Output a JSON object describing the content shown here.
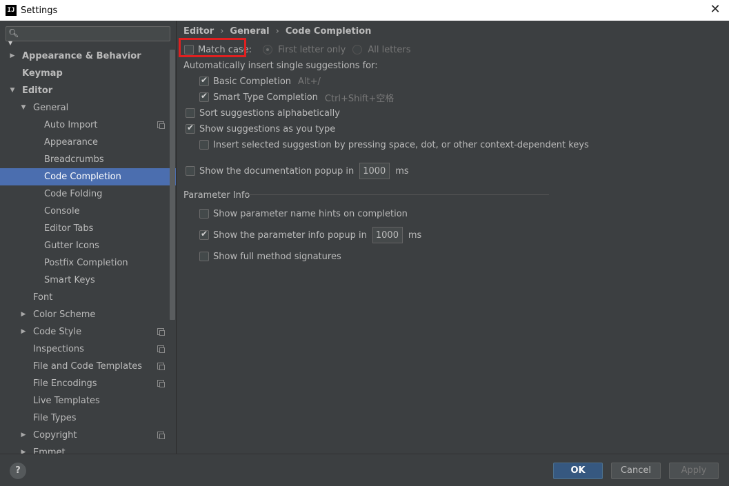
{
  "window": {
    "title": "Settings",
    "app_icon": "IJ"
  },
  "search": {
    "placeholder": ""
  },
  "sidebar": {
    "items": [
      {
        "label": "Appearance & Behavior",
        "arrow": "▶",
        "bold": true
      },
      {
        "label": "Keymap",
        "bold": true
      },
      {
        "label": "Editor",
        "arrow": "▼",
        "bold": true
      },
      {
        "label": "General",
        "arrow": "▼"
      },
      {
        "label": "Auto Import",
        "copy": true
      },
      {
        "label": "Appearance"
      },
      {
        "label": "Breadcrumbs"
      },
      {
        "label": "Code Completion",
        "selected": true
      },
      {
        "label": "Code Folding"
      },
      {
        "label": "Console"
      },
      {
        "label": "Editor Tabs"
      },
      {
        "label": "Gutter Icons"
      },
      {
        "label": "Postfix Completion"
      },
      {
        "label": "Smart Keys"
      },
      {
        "label": "Font"
      },
      {
        "label": "Color Scheme",
        "arrow": "▶"
      },
      {
        "label": "Code Style",
        "arrow": "▶",
        "copy": true
      },
      {
        "label": "Inspections",
        "copy": true
      },
      {
        "label": "File and Code Templates",
        "copy": true
      },
      {
        "label": "File Encodings",
        "copy": true
      },
      {
        "label": "Live Templates"
      },
      {
        "label": "File Types"
      },
      {
        "label": "Copyright",
        "arrow": "▶",
        "copy": true
      },
      {
        "label": "Emmet",
        "arrow": "▶"
      }
    ]
  },
  "breadcrumb": {
    "items": [
      "Editor",
      "General",
      "Code Completion"
    ],
    "separator": "›"
  },
  "main": {
    "match_case": {
      "label": "Match case:",
      "checked": false
    },
    "first_letter_only": "First letter only",
    "all_letters": "All letters",
    "auto_insert_title": "Automatically insert single suggestions for:",
    "basic_completion": {
      "label": "Basic Completion",
      "shortcut": "Alt+/",
      "checked": true
    },
    "smart_type_completion": {
      "label": "Smart Type Completion",
      "shortcut": "Ctrl+Shift+空格",
      "checked": true
    },
    "sort_alpha": {
      "label": "Sort suggestions alphabetically",
      "checked": false
    },
    "show_as_you_type": {
      "label": "Show suggestions as you type",
      "checked": true
    },
    "insert_selected": {
      "label": "Insert selected suggestion by pressing space, dot, or other context-dependent keys",
      "checked": false
    },
    "doc_popup": {
      "label": "Show the documentation popup in",
      "value": "1000",
      "unit": "ms",
      "checked": false
    },
    "param_info": {
      "title": "Parameter Info",
      "name_hints": {
        "label": "Show parameter name hints on completion",
        "checked": false
      },
      "info_popup": {
        "label": "Show the parameter info popup in",
        "value": "1000",
        "unit": "ms",
        "checked": true
      },
      "full_signatures": {
        "label": "Show full method signatures",
        "checked": false
      }
    }
  },
  "buttons": {
    "ok": "OK",
    "cancel": "Cancel",
    "apply": "Apply",
    "help": "?"
  },
  "colors": {
    "selection": "#4b6eaf",
    "highlight_border": "#e02020",
    "primary_button": "#365880"
  }
}
